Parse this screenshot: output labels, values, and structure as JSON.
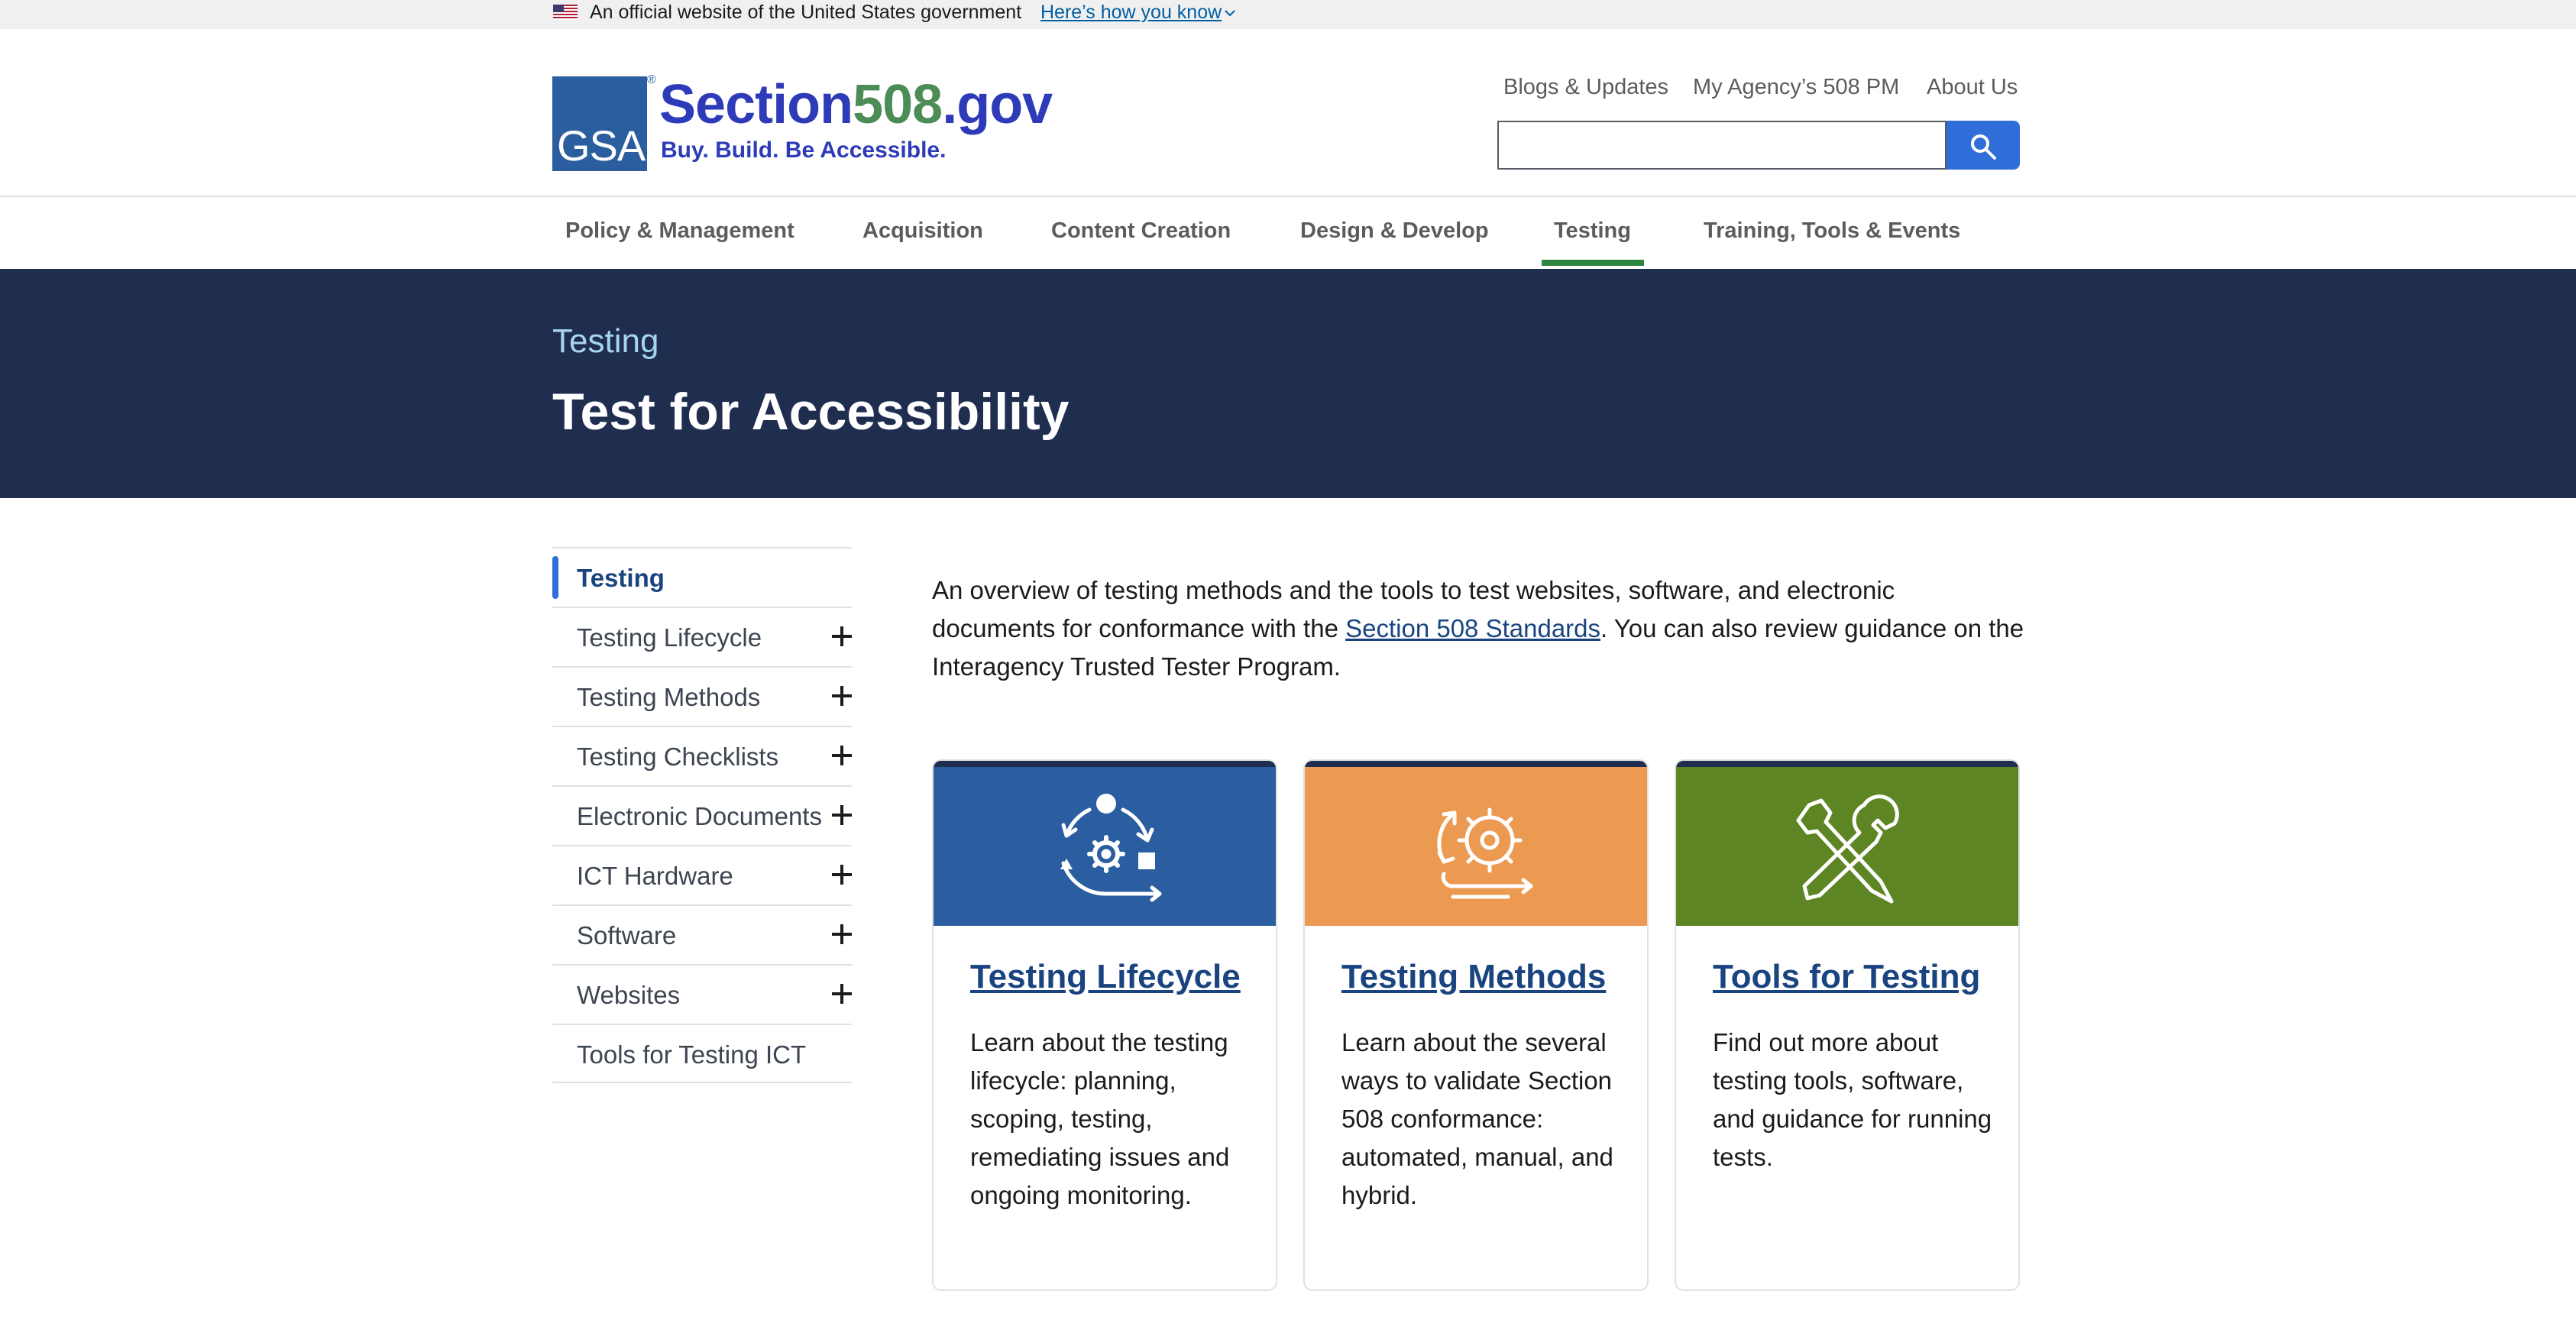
{
  "banner": {
    "official_text": "An official website of the United States government",
    "how_link": "Here’s how you know"
  },
  "logo": {
    "agency": "GSA",
    "title_prefix": "Section",
    "title_number": "508",
    "title_suffix": ".gov",
    "tagline": "Buy. Build. Be Accessible."
  },
  "utility_nav": [
    "Blogs & Updates",
    "My Agency’s 508 PM",
    "About Us"
  ],
  "search": {
    "value": "",
    "placeholder": ""
  },
  "main_nav": {
    "items": [
      "Policy & Management",
      "Acquisition",
      "Content Creation",
      "Design & Develop",
      "Testing",
      "Training, Tools & Events"
    ],
    "active": "Testing"
  },
  "hero": {
    "eyebrow": "Testing",
    "title": "Test for Accessibility"
  },
  "sidenav": {
    "items": [
      {
        "label": "Testing",
        "current": true,
        "expandable": false
      },
      {
        "label": "Testing Lifecycle",
        "expandable": true
      },
      {
        "label": "Testing Methods",
        "expandable": true
      },
      {
        "label": "Testing Checklists",
        "expandable": true
      },
      {
        "label": "Electronic Documents",
        "expandable": true
      },
      {
        "label": "ICT Hardware",
        "expandable": true
      },
      {
        "label": "Software",
        "expandable": true
      },
      {
        "label": "Websites",
        "expandable": true
      },
      {
        "label": "Tools for Testing ICT",
        "expandable": false
      }
    ]
  },
  "intro": {
    "text_before": "An overview of testing methods and the tools to test websites, software, and electronic documents for conformance with the ",
    "link": "Section 508 Standards",
    "text_after": ". You can also review guidance on the Interagency Trusted Tester Program."
  },
  "cards": [
    {
      "title": "Testing Lifecycle",
      "body": "Learn about the testing lifecycle: planning, scoping, testing, remediating issues and ongoing monitoring.",
      "color": "#2a5ea0",
      "icon": "lifecycle-icon"
    },
    {
      "title": "Testing Methods",
      "body": "Learn about the several ways to validate Section 508 conformance: automated, manual, and hybrid.",
      "color": "#ec9a52",
      "icon": "gear-cycle-icon"
    },
    {
      "title": "Tools for Testing",
      "body": "Find out more about testing tools, software, and guidance for running tests.",
      "color": "#5d8523",
      "icon": "tools-icon"
    }
  ],
  "colors": {
    "hero_bg": "#1f2e4f",
    "link": "#1a4480",
    "active_underline": "#2e8540",
    "search_button": "#2f6ed8"
  }
}
